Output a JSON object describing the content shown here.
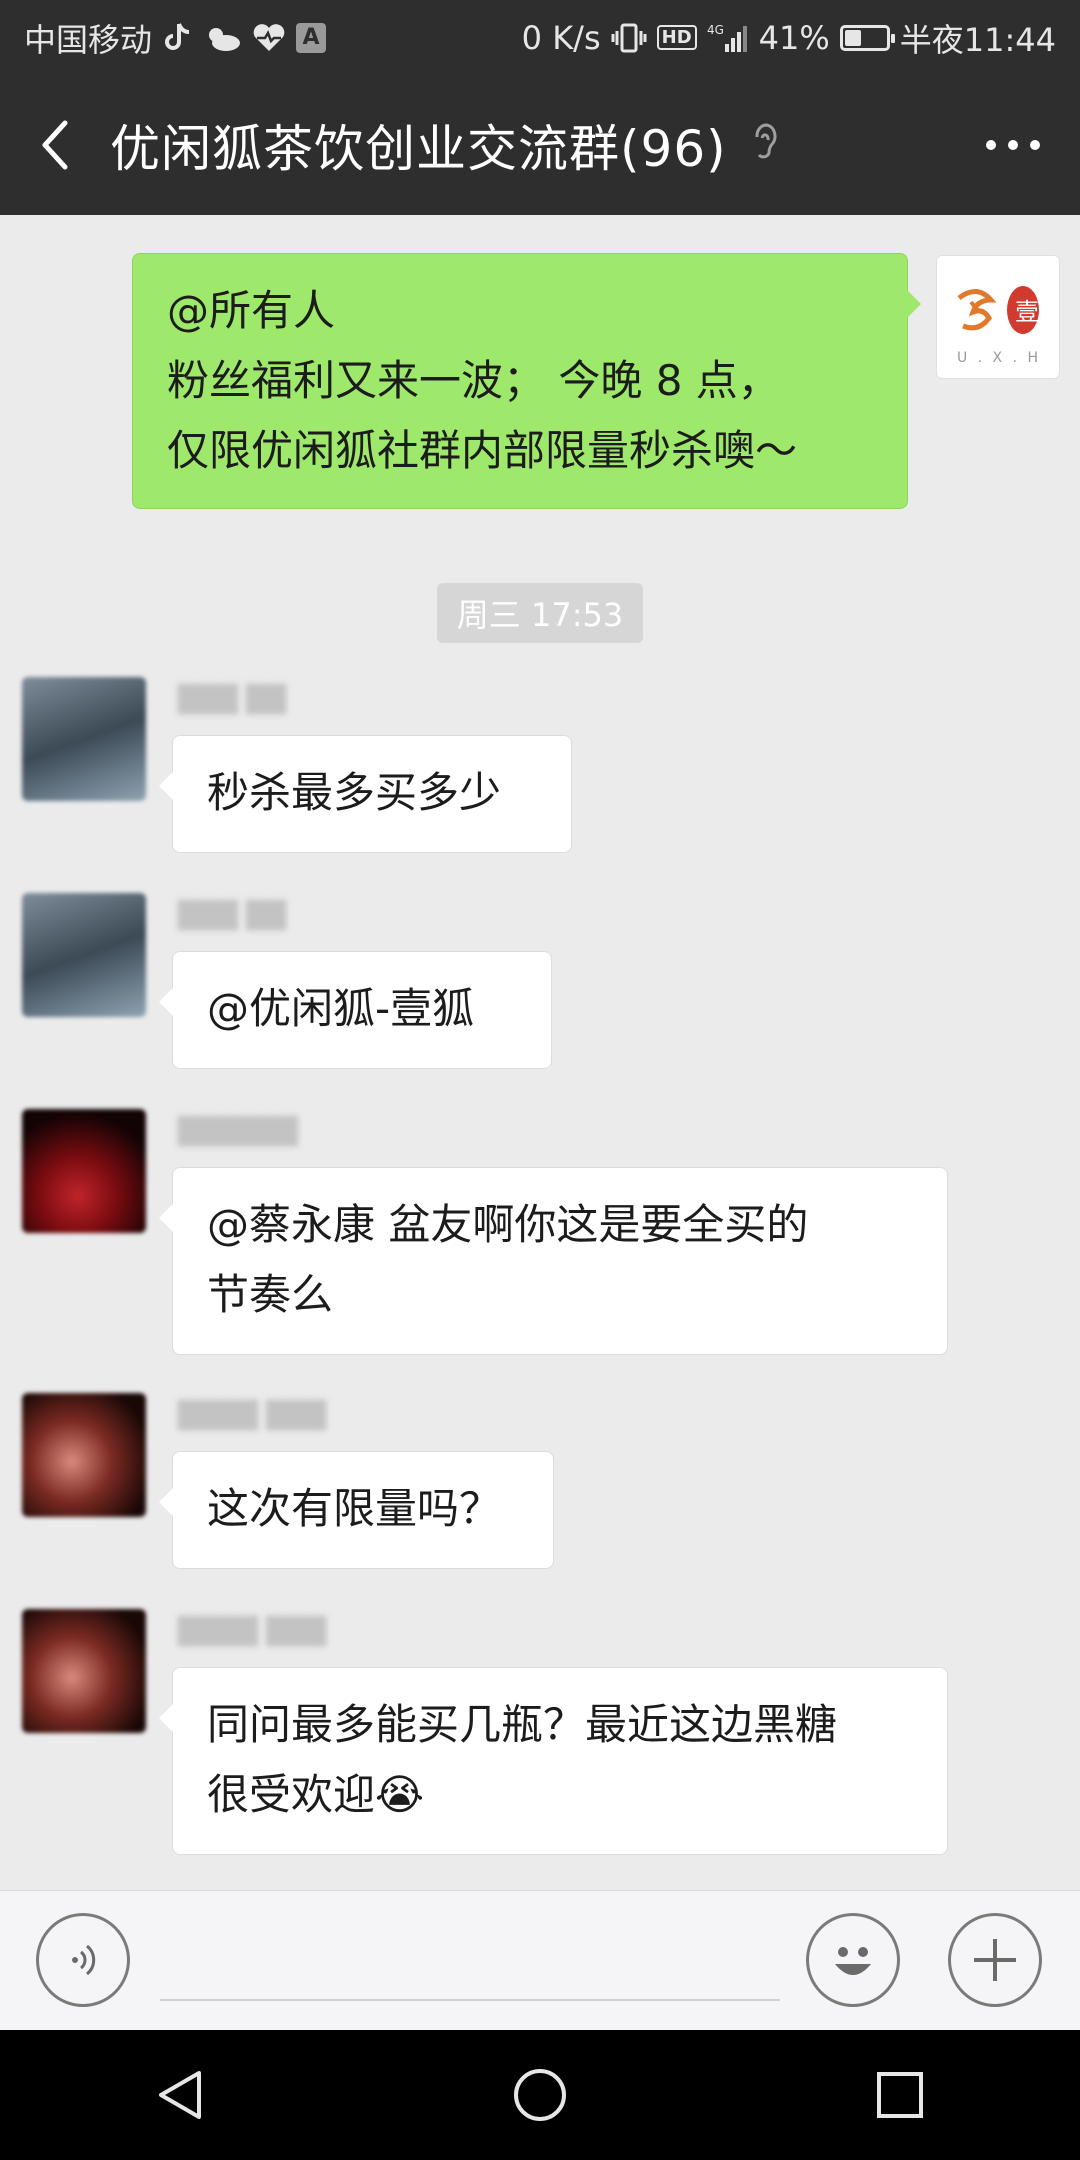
{
  "status_bar": {
    "carrier": "中国移动",
    "speed": "0 K/s",
    "network": "4G",
    "hd": "HD",
    "a_badge": "A",
    "battery_text": "41%",
    "battery_level": 0.41,
    "time": "半夜11:44"
  },
  "header": {
    "title": "优闲狐茶饮创业交流群(96)"
  },
  "messages": [
    {
      "side": "right",
      "lines": [
        "@所有人",
        "粉丝福利又来一波； 今晚 8 点，",
        "仅限优闲狐社群内部限量秒杀噢～"
      ],
      "avatar_text": "U . X . H",
      "avatar_mark": "壹"
    },
    {
      "side": "left",
      "lines": [
        "秒杀最多买多少"
      ]
    },
    {
      "side": "left",
      "lines": [
        "@优闲狐-壹狐"
      ]
    },
    {
      "side": "left",
      "lines": [
        "@蔡永康  盆友啊你这是要全买的",
        "节奏么"
      ]
    },
    {
      "side": "left",
      "lines": [
        "这次有限量吗？"
      ]
    },
    {
      "side": "left",
      "lines": [
        "同问最多能买几瓶？最近这边黑糖",
        "很受欢迎😭"
      ]
    }
  ],
  "timestamp": "周三 17:53",
  "colors": {
    "header_bg": "#2e2e2e",
    "chat_bg": "#ebebeb",
    "green_bubble": "#9ee86b",
    "white_bubble": "#ffffff"
  },
  "icons": {
    "back": "chevron-left-icon",
    "ear": "earpiece-mode-icon",
    "more": "more-dots-icon",
    "voice": "voice-input-icon",
    "emoji": "emoji-icon",
    "plus": "plus-icon"
  }
}
